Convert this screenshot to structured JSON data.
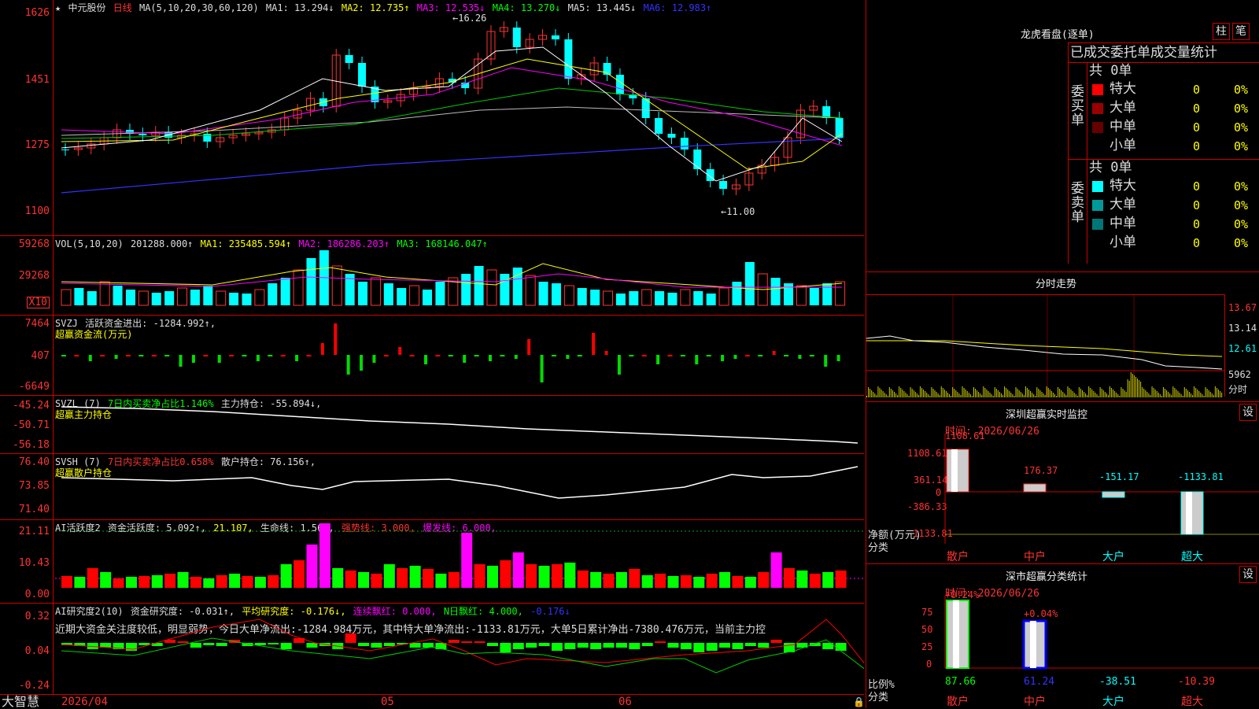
{
  "stock": {
    "name": "中元股份",
    "period": "日线"
  },
  "main": {
    "ma_label": "MA(5,10,20,30,60,120)",
    "ma1": "MA1: 13.294↓",
    "ma2": "MA2: 12.735↑",
    "ma3": "MA3: 12.535↓",
    "ma4": "MA4: 13.270↓",
    "ma5": "MA5: 13.445↓",
    "ma6": "MA6: 12.983↑",
    "high_label": "16.26",
    "low_label": "11.00",
    "axis": [
      "1626",
      "1451",
      "1275",
      "1100"
    ]
  },
  "vol": {
    "label": "VOL(5,10,20)",
    "value": "201288.000↑",
    "ma1": "MA1: 235485.594↑",
    "ma2": "MA2: 186286.203↑",
    "ma3": "MA3: 168146.047↑",
    "axis": [
      "59268",
      "29268"
    ],
    "unit": "X10"
  },
  "svzj": {
    "label": "SVZJ",
    "title": "活跃资金进出: -1284.992↑,",
    "subtitle": "超赢资金流(万元)",
    "axis": [
      "7464",
      "407",
      "-6649"
    ]
  },
  "svzl": {
    "label": "SVZL (7)",
    "ratio": "7日内买卖净占比1.146%",
    "hold": "主力持仓: -55.894↓,",
    "subtitle": "超赢主力持仓",
    "axis": [
      "-45.24",
      "-50.71",
      "-56.18"
    ]
  },
  "svsh": {
    "label": "SVSH (7)",
    "ratio": "7日内买卖净占比0.658%",
    "hold": "散户持仓: 76.156↑,",
    "subtitle": "超赢散户持仓",
    "axis": [
      "76.40",
      "73.85",
      "71.40"
    ]
  },
  "ai1": {
    "label": "AI活跃度2",
    "v1": "资金活跃度: 5.092↑,",
    "v2": "21.107,",
    "v3": "生命线: 1.560,",
    "v4": "强势线: 3.000,",
    "v5": "爆发线: 6.000,",
    "axis": [
      "21.11",
      "10.43",
      "0.00"
    ]
  },
  "ai2": {
    "label": "AI研究度2(10)",
    "v1": "资金研究度: -0.031↑,",
    "v2": "平均研究度: -0.176↓,",
    "v3": "连续飘红: 0.000,",
    "v4": "N日飘红: 4.000,",
    "v5": "-0.176↓",
    "comment": "近期大资金关注度较低，明显弱势，今日大单净流出:-1284.984万元，其中特大单净流出:-1133.81万元，大单5日累计净出-7380.476万元，当前主力控",
    "axis": [
      "0.32",
      "0.04",
      "-0.24"
    ]
  },
  "bottom": {
    "logo": "大智慧",
    "dates": [
      "2026/04",
      "05",
      "06"
    ]
  },
  "longhu": {
    "title": "龙虎看盘(逐单)",
    "btn1": "柱",
    "btn2": "笔",
    "header": "已成交委托单成交量统计",
    "buy_label": "委买单",
    "sell_label": "委卖单",
    "buy_total": "共 0单",
    "sell_total": "共 0单",
    "buy_rows": [
      {
        "label": "特大",
        "count": "0",
        "pct": "0%",
        "color": "#ff0000"
      },
      {
        "label": "大单",
        "count": "0",
        "pct": "0%",
        "color": "#990000"
      },
      {
        "label": "中单",
        "count": "0",
        "pct": "0%",
        "color": "#660000"
      },
      {
        "label": "小单",
        "count": "0",
        "pct": "0%",
        "color": ""
      }
    ],
    "sell_rows": [
      {
        "label": "特大",
        "count": "0",
        "pct": "0%",
        "color": "#00ffff"
      },
      {
        "label": "大单",
        "count": "0",
        "pct": "0%",
        "color": "#009999"
      },
      {
        "label": "中单",
        "count": "0",
        "pct": "0%",
        "color": "#007777"
      },
      {
        "label": "小单",
        "count": "0",
        "pct": "0%",
        "color": ""
      }
    ]
  },
  "intraday": {
    "title": "分时走势",
    "axis": [
      "13.67",
      "13.14",
      "12.61"
    ],
    "vol": "5962",
    "unit": "分时"
  },
  "sz_monitor": {
    "title": "深圳超赢实时监控",
    "btn": "设",
    "time": "时间: 2026/06/26",
    "axis": [
      "1108.61",
      "361.14",
      "0",
      "-386.33",
      "-1133.81"
    ],
    "ylabel": "净额(万元)",
    "xlabel": "分类",
    "bars": [
      {
        "cat": "散户",
        "value": "1108.61"
      },
      {
        "cat": "中户",
        "value": "176.37"
      },
      {
        "cat": "大户",
        "value": "-151.17"
      },
      {
        "cat": "超大",
        "value": "-1133.81"
      }
    ]
  },
  "sz_class": {
    "title": "深市超赢分类统计",
    "btn": "设",
    "time": "时间: 2026/06/26",
    "axis": [
      "75",
      "50",
      "25",
      "0"
    ],
    "ylabel": "比例%",
    "xlabel": "分类",
    "bars": [
      {
        "cat": "散户",
        "top": "+0.24%",
        "value": "87.66"
      },
      {
        "cat": "中户",
        "top": "+0.04%",
        "value": "61.24"
      },
      {
        "cat": "大户",
        "top": "",
        "value": "-38.51"
      },
      {
        "cat": "超大",
        "top": "",
        "value": "-10.39"
      }
    ]
  }
}
